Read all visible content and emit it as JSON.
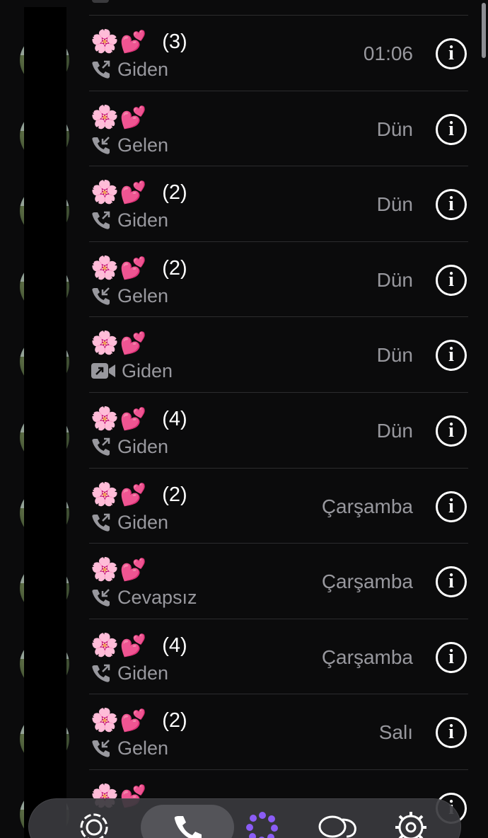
{
  "calls": [
    {
      "name_emoji": "🌸💕",
      "count": "(3)",
      "type": "Giden",
      "direction": "outgoing",
      "media": "audio",
      "time": "01:06"
    },
    {
      "name_emoji": "🌸💕",
      "count": "",
      "type": "Gelen",
      "direction": "incoming",
      "media": "audio",
      "time": "Dün"
    },
    {
      "name_emoji": "🌸💕",
      "count": "(2)",
      "type": "Giden",
      "direction": "outgoing",
      "media": "audio",
      "time": "Dün"
    },
    {
      "name_emoji": "🌸💕",
      "count": "(2)",
      "type": "Gelen",
      "direction": "incoming",
      "media": "audio",
      "time": "Dün"
    },
    {
      "name_emoji": "🌸💕",
      "count": "",
      "type": "Giden",
      "direction": "outgoing",
      "media": "video",
      "time": "Dün"
    },
    {
      "name_emoji": "🌸💕",
      "count": "(4)",
      "type": "Giden",
      "direction": "outgoing",
      "media": "audio",
      "time": "Dün"
    },
    {
      "name_emoji": "🌸💕",
      "count": "(2)",
      "type": "Giden",
      "direction": "outgoing",
      "media": "audio",
      "time": "Çarşamba"
    },
    {
      "name_emoji": "🌸💕",
      "count": "",
      "type": "Cevapsız",
      "direction": "incoming",
      "media": "audio",
      "time": "Çarşamba"
    },
    {
      "name_emoji": "🌸💕",
      "count": "(4)",
      "type": "Giden",
      "direction": "outgoing",
      "media": "audio",
      "time": "Çarşamba"
    },
    {
      "name_emoji": "🌸💕",
      "count": "(2)",
      "type": "Gelen",
      "direction": "incoming",
      "media": "audio",
      "time": "Salı"
    },
    {
      "name_emoji": "🌸💕",
      "count": "",
      "type": "",
      "direction": "outgoing",
      "media": "audio",
      "time": ""
    }
  ],
  "tabbar": {
    "tabs": [
      {
        "icon": "updates-icon"
      },
      {
        "icon": "phone-icon",
        "active": true
      },
      {
        "icon": "communities-icon"
      },
      {
        "icon": "chats-icon"
      },
      {
        "icon": "settings-icon"
      }
    ]
  },
  "colors": {
    "background": "#0b0b0c",
    "secondary_text": "#98989e",
    "separator": "#2c2c2e",
    "tab_bar": "#3a3a3e"
  }
}
